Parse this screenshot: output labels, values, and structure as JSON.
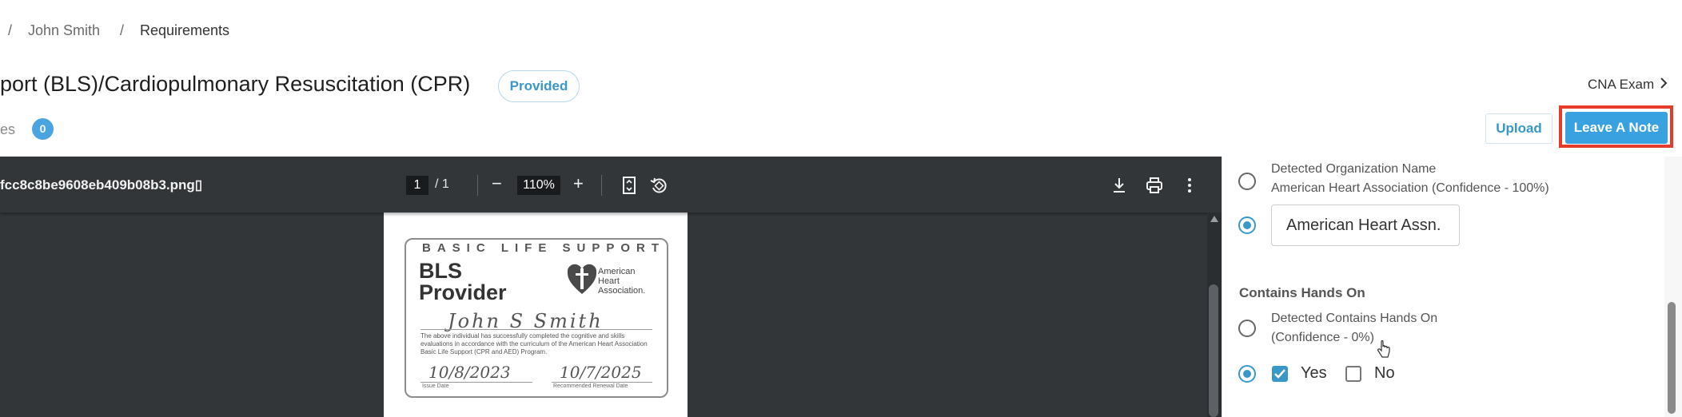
{
  "breadcrumb": {
    "sep1": "/",
    "name": "John Smith",
    "sep2": "/",
    "current": "Requirements"
  },
  "header": {
    "title": "port (BLS)/Cardiopulmonary Resuscitation (CPR)",
    "status": "Provided",
    "notes_label": "es",
    "notes_count": "0",
    "next_link": "CNA Exam",
    "upload": "Upload",
    "leave_note": "Leave A Note"
  },
  "viewer": {
    "filename": "fcc8c8be9608eb409b08b3.png⁠▯",
    "page": "1",
    "page_total": "/  1",
    "zoom_minus": "−",
    "zoom": "110%",
    "zoom_plus": "+",
    "icons": [
      "fit-page-icon",
      "rotate-icon",
      "download-icon",
      "print-icon",
      "more-vert-icon"
    ]
  },
  "card": {
    "header": "BASIC LIFE SUPPORT",
    "line1": "BLS",
    "line2": "Provider",
    "org1": "American",
    "org2": "Heart",
    "org3": "Association.",
    "name": "John S Smith",
    "body": "The above individual has successfully completed the cognitive and skills evaluations in accordance with the curriculum of the American Heart Association Basic Life Support (CPR and AED) Program.",
    "issue": "10/8/2023",
    "issue_label": "Issue Date",
    "renew": "10/7/2025",
    "renew_label": "Recommended Renewal Date"
  },
  "panel": {
    "org_detected_line1": "Detected Organization Name",
    "org_detected_line2": "American Heart Association (Confidence - 100%)",
    "org_input_value": "American Heart Assn.",
    "hands_title": "Contains Hands On",
    "hands_detected_line1": "Detected Contains Hands On",
    "hands_detected_line2": "(Confidence - 0%)",
    "yes": "Yes",
    "no": "No"
  },
  "colors": {
    "accent": "#3aa1e0",
    "highlight": "#e53a2c",
    "viewer_bg": "#323639"
  }
}
